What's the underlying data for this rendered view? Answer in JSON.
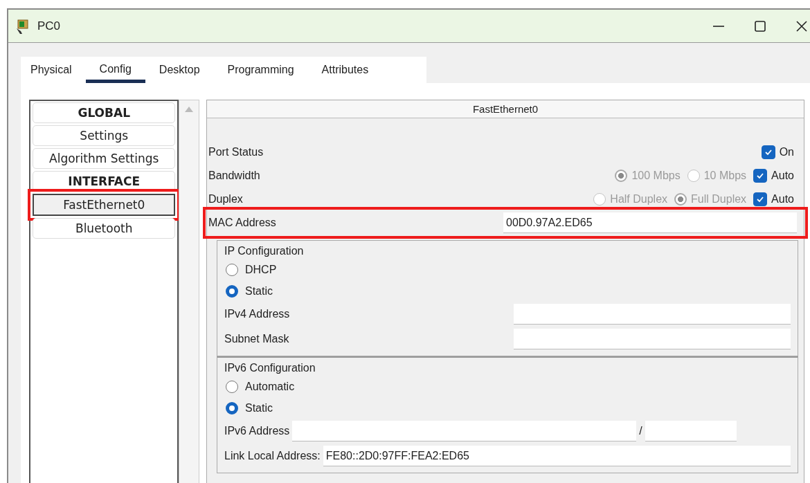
{
  "window": {
    "title": "PC0"
  },
  "tabs": [
    {
      "label": "Physical",
      "selected": false
    },
    {
      "label": "Config",
      "selected": true
    },
    {
      "label": "Desktop",
      "selected": false
    },
    {
      "label": "Programming",
      "selected": false
    },
    {
      "label": "Attributes",
      "selected": false
    }
  ],
  "sidebar": {
    "items": [
      {
        "kind": "header",
        "label": "GLOBAL",
        "selected": false,
        "highlighted": false
      },
      {
        "kind": "item",
        "label": "Settings",
        "selected": false,
        "highlighted": false
      },
      {
        "kind": "item",
        "label": "Algorithm Settings",
        "selected": false,
        "highlighted": false
      },
      {
        "kind": "header",
        "label": "INTERFACE",
        "selected": false,
        "highlighted": false
      },
      {
        "kind": "item",
        "label": "FastEthernet0",
        "selected": true,
        "highlighted": true
      },
      {
        "kind": "item",
        "label": "Bluetooth",
        "selected": false,
        "highlighted": false
      }
    ]
  },
  "interface": {
    "title": "FastEthernet0",
    "rows": [
      {
        "kind": "options",
        "label": "Port Status",
        "highlighted": false,
        "options": [
          {
            "kind": "checkbox",
            "label": "On",
            "checked": true,
            "disabled": false
          }
        ]
      },
      {
        "kind": "options",
        "label": "Bandwidth",
        "highlighted": false,
        "options": [
          {
            "kind": "radio",
            "label": "100 Mbps",
            "selected": true,
            "disabled": true
          },
          {
            "kind": "radio",
            "label": "10 Mbps",
            "selected": false,
            "disabled": true
          },
          {
            "kind": "checkbox",
            "label": "Auto",
            "checked": true,
            "disabled": false
          }
        ]
      },
      {
        "kind": "options",
        "label": "Duplex",
        "highlighted": false,
        "options": [
          {
            "kind": "radio",
            "label": "Half Duplex",
            "selected": false,
            "disabled": true
          },
          {
            "kind": "radio",
            "label": "Full Duplex",
            "selected": true,
            "disabled": true
          },
          {
            "kind": "checkbox",
            "label": "Auto",
            "checked": true,
            "disabled": false
          }
        ]
      },
      {
        "kind": "field",
        "label": "MAC Address",
        "value": "00D0.97A2.ED65",
        "highlighted": true
      }
    ]
  },
  "ip_config": {
    "title": "IP Configuration",
    "modes": [
      {
        "label": "DHCP",
        "selected": false
      },
      {
        "label": "Static",
        "selected": true
      }
    ],
    "fields": [
      {
        "kind": "short",
        "label": "IPv4 Address"
      },
      {
        "kind": "short",
        "label": "Subnet Mask"
      }
    ]
  },
  "ipv6_config": {
    "title": "IPv6 Configuration",
    "modes": [
      {
        "label": "Automatic",
        "selected": false
      },
      {
        "label": "Static",
        "selected": true
      }
    ],
    "fields": [
      {
        "kind": "prefix",
        "label": "IPv6 Address",
        "separator": "/"
      },
      {
        "kind": "wide",
        "label": "Link Local Address:",
        "value": "FE80::2D0:97FF:FEA2:ED65"
      }
    ]
  }
}
